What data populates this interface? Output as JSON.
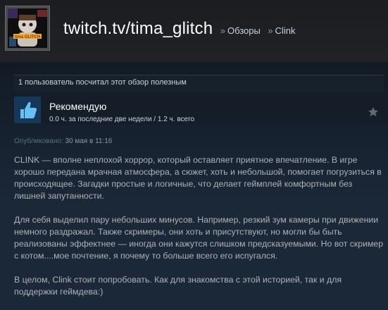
{
  "header": {
    "persona_name": "twitch.tv/tima_glitch",
    "separator": "»",
    "breadcrumb_reviews": "Обзоры",
    "breadcrumb_game": "Clink",
    "avatar_text": "tima GLITCH"
  },
  "review": {
    "helpful_text": "1 пользователь посчитал этот обзор полезным",
    "verdict": "Рекомендую",
    "hours": "0.0 ч. за последние две недели / 1.2 ч. всего",
    "posted_label": "Опубликовано:",
    "posted_date": "30 мая в 11:16",
    "paragraphs": [
      "CLINK — вполне неплохой хоррор, который оставляет приятное впечатление. В игре хорошо передана мрачная атмосфера, а сюжет, хоть и небольшой, помогает погрузиться в происходящее. Загадки простые и логичные, что делает геймплей комфортным без лишней запутанности.",
      "Для себя выделил пару небольших минусов. Например, резкий зум камеры при движении немного раздражал. Также скримеры, они хоть и присутствуют, но могли бы быть реализованы эффектнее — иногда они кажутся слишком предсказуемыми. Но вот скример с котом....мое почтение, я почему то больше всего его испугался.",
      "В целом, Clink стоит попробовать. Как для знакомства с этой историей, так и для поддержки геймдева:)"
    ]
  },
  "icons": {
    "avatar": "avatar-image",
    "thumb": "thumbs-up-icon",
    "star": "star-icon"
  },
  "colors": {
    "background": "#1b2838",
    "header": "#1f2024",
    "text": "#acb2b8",
    "accent": "#66c0f4"
  }
}
